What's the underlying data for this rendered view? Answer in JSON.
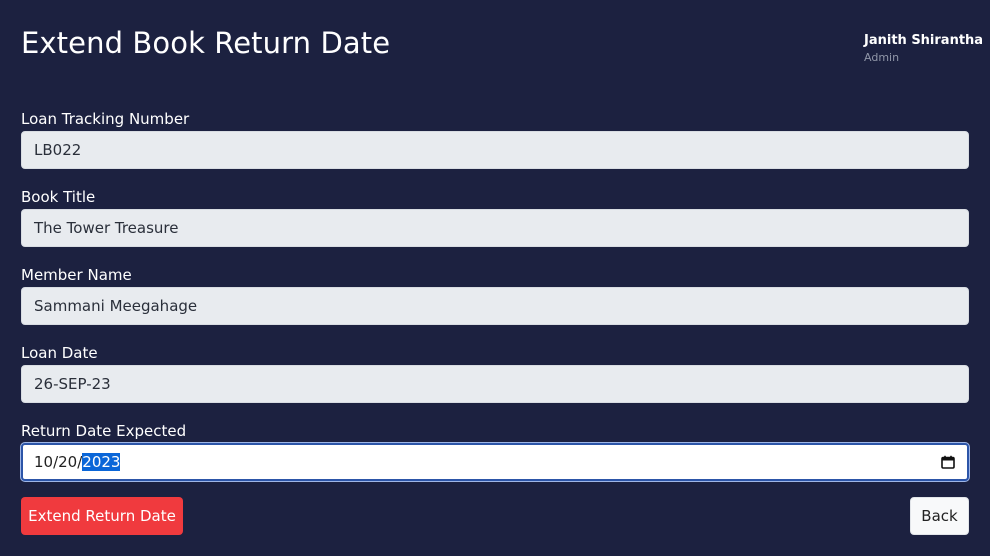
{
  "header": {
    "title": "Extend Book Return Date",
    "user_name": "Janith Shirantha",
    "user_role": "Admin"
  },
  "form": {
    "loan_tracking_number": {
      "label": "Loan Tracking Number",
      "value": "LB022"
    },
    "book_title": {
      "label": "Book Title",
      "value": "The Tower Treasure"
    },
    "member_name": {
      "label": "Member Name",
      "value": "Sammani Meegahage"
    },
    "loan_date": {
      "label": "Loan Date",
      "value": "26-SEP-23"
    },
    "return_date_expected": {
      "label": "Return Date Expected",
      "value_prefix": "10/20/",
      "value_selected": "2023",
      "icon": "calendar-icon"
    }
  },
  "actions": {
    "extend_label": "Extend Return Date",
    "back_label": "Back"
  },
  "colors": {
    "background": "#1c2140",
    "extend_button": "#f03a3e",
    "focus_border": "#2c55a8",
    "selection": "#0a66d8"
  }
}
